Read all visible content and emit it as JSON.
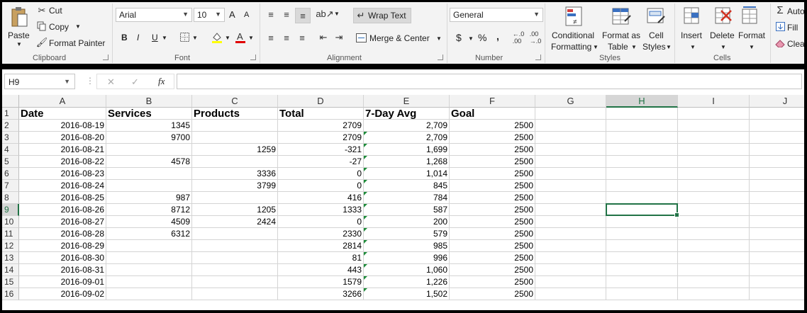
{
  "ribbon": {
    "clipboard": {
      "label": "Clipboard",
      "paste": "Paste",
      "cut": "Cut",
      "copy": "Copy",
      "format_painter": "Format Painter"
    },
    "font": {
      "label": "Font",
      "name": "Arial",
      "size": "10",
      "bold": "B",
      "italic": "I",
      "underline": "U",
      "grow": "A",
      "shrink": "A"
    },
    "alignment": {
      "label": "Alignment",
      "wrap_text": "Wrap Text",
      "merge_center": "Merge & Center"
    },
    "number": {
      "label": "Number",
      "format": "General",
      "currency": "$",
      "percent": "%",
      "comma": ",",
      "inc_dec": "←.0 .00",
      "dec_dec": ".00 →.0"
    },
    "styles": {
      "label": "Styles",
      "conditional_1": "Conditional",
      "conditional_2": "Formatting",
      "format_table_1": "Format as",
      "format_table_2": "Table",
      "cell_styles_1": "Cell",
      "cell_styles_2": "Styles"
    },
    "cells": {
      "label": "Cells",
      "insert": "Insert",
      "delete": "Delete",
      "format": "Format"
    },
    "editing": {
      "autosum": "Auto",
      "fill": "Fill",
      "clear": "Clea"
    }
  },
  "formula_bar": {
    "name_box": "H9",
    "fx": "fx",
    "cancel": "✕",
    "enter": "✓",
    "value": ""
  },
  "sheet": {
    "columns": [
      "A",
      "B",
      "C",
      "D",
      "E",
      "F",
      "G",
      "H",
      "I",
      "J"
    ],
    "selected_cell": "H9",
    "header_row": {
      "row": "1",
      "cells": [
        "Date",
        "Services",
        "Products",
        "Total",
        "7-Day Avg",
        "Goal",
        "",
        "",
        "",
        ""
      ]
    },
    "rows": [
      {
        "row": "2",
        "cells": [
          "2016-08-19",
          "1345",
          "",
          "2709",
          "2,709",
          "2500"
        ]
      },
      {
        "row": "3",
        "cells": [
          "2016-08-20",
          "9700",
          "",
          "2709",
          "2,709",
          "2500"
        ]
      },
      {
        "row": "4",
        "cells": [
          "2016-08-21",
          "",
          "1259",
          "-321",
          "1,699",
          "2500"
        ]
      },
      {
        "row": "5",
        "cells": [
          "2016-08-22",
          "4578",
          "",
          "-27",
          "1,268",
          "2500"
        ]
      },
      {
        "row": "6",
        "cells": [
          "2016-08-23",
          "",
          "3336",
          "0",
          "1,014",
          "2500"
        ]
      },
      {
        "row": "7",
        "cells": [
          "2016-08-24",
          "",
          "3799",
          "0",
          "845",
          "2500"
        ]
      },
      {
        "row": "8",
        "cells": [
          "2016-08-25",
          "987",
          "",
          "416",
          "784",
          "2500"
        ]
      },
      {
        "row": "9",
        "cells": [
          "2016-08-26",
          "8712",
          "1205",
          "1333",
          "587",
          "2500"
        ]
      },
      {
        "row": "10",
        "cells": [
          "2016-08-27",
          "4509",
          "2424",
          "0",
          "200",
          "2500"
        ]
      },
      {
        "row": "11",
        "cells": [
          "2016-08-28",
          "6312",
          "",
          "2330",
          "579",
          "2500"
        ]
      },
      {
        "row": "12",
        "cells": [
          "2016-08-29",
          "",
          "",
          "2814",
          "985",
          "2500"
        ]
      },
      {
        "row": "13",
        "cells": [
          "2016-08-30",
          "",
          "",
          "81",
          "996",
          "2500"
        ]
      },
      {
        "row": "14",
        "cells": [
          "2016-08-31",
          "",
          "",
          "443",
          "1,060",
          "2500"
        ]
      },
      {
        "row": "15",
        "cells": [
          "2016-09-01",
          "",
          "",
          "1579",
          "1,226",
          "2500"
        ]
      },
      {
        "row": "16",
        "cells": [
          "2016-09-02",
          "",
          "",
          "3266",
          "1,502",
          "2500"
        ]
      }
    ],
    "warn_rows": [
      "3",
      "4",
      "5",
      "6",
      "7",
      "8",
      "9",
      "10",
      "11",
      "12",
      "13",
      "14",
      "15",
      "16"
    ],
    "accent": "#217346",
    "indicator_color": "#1e8c3a"
  }
}
